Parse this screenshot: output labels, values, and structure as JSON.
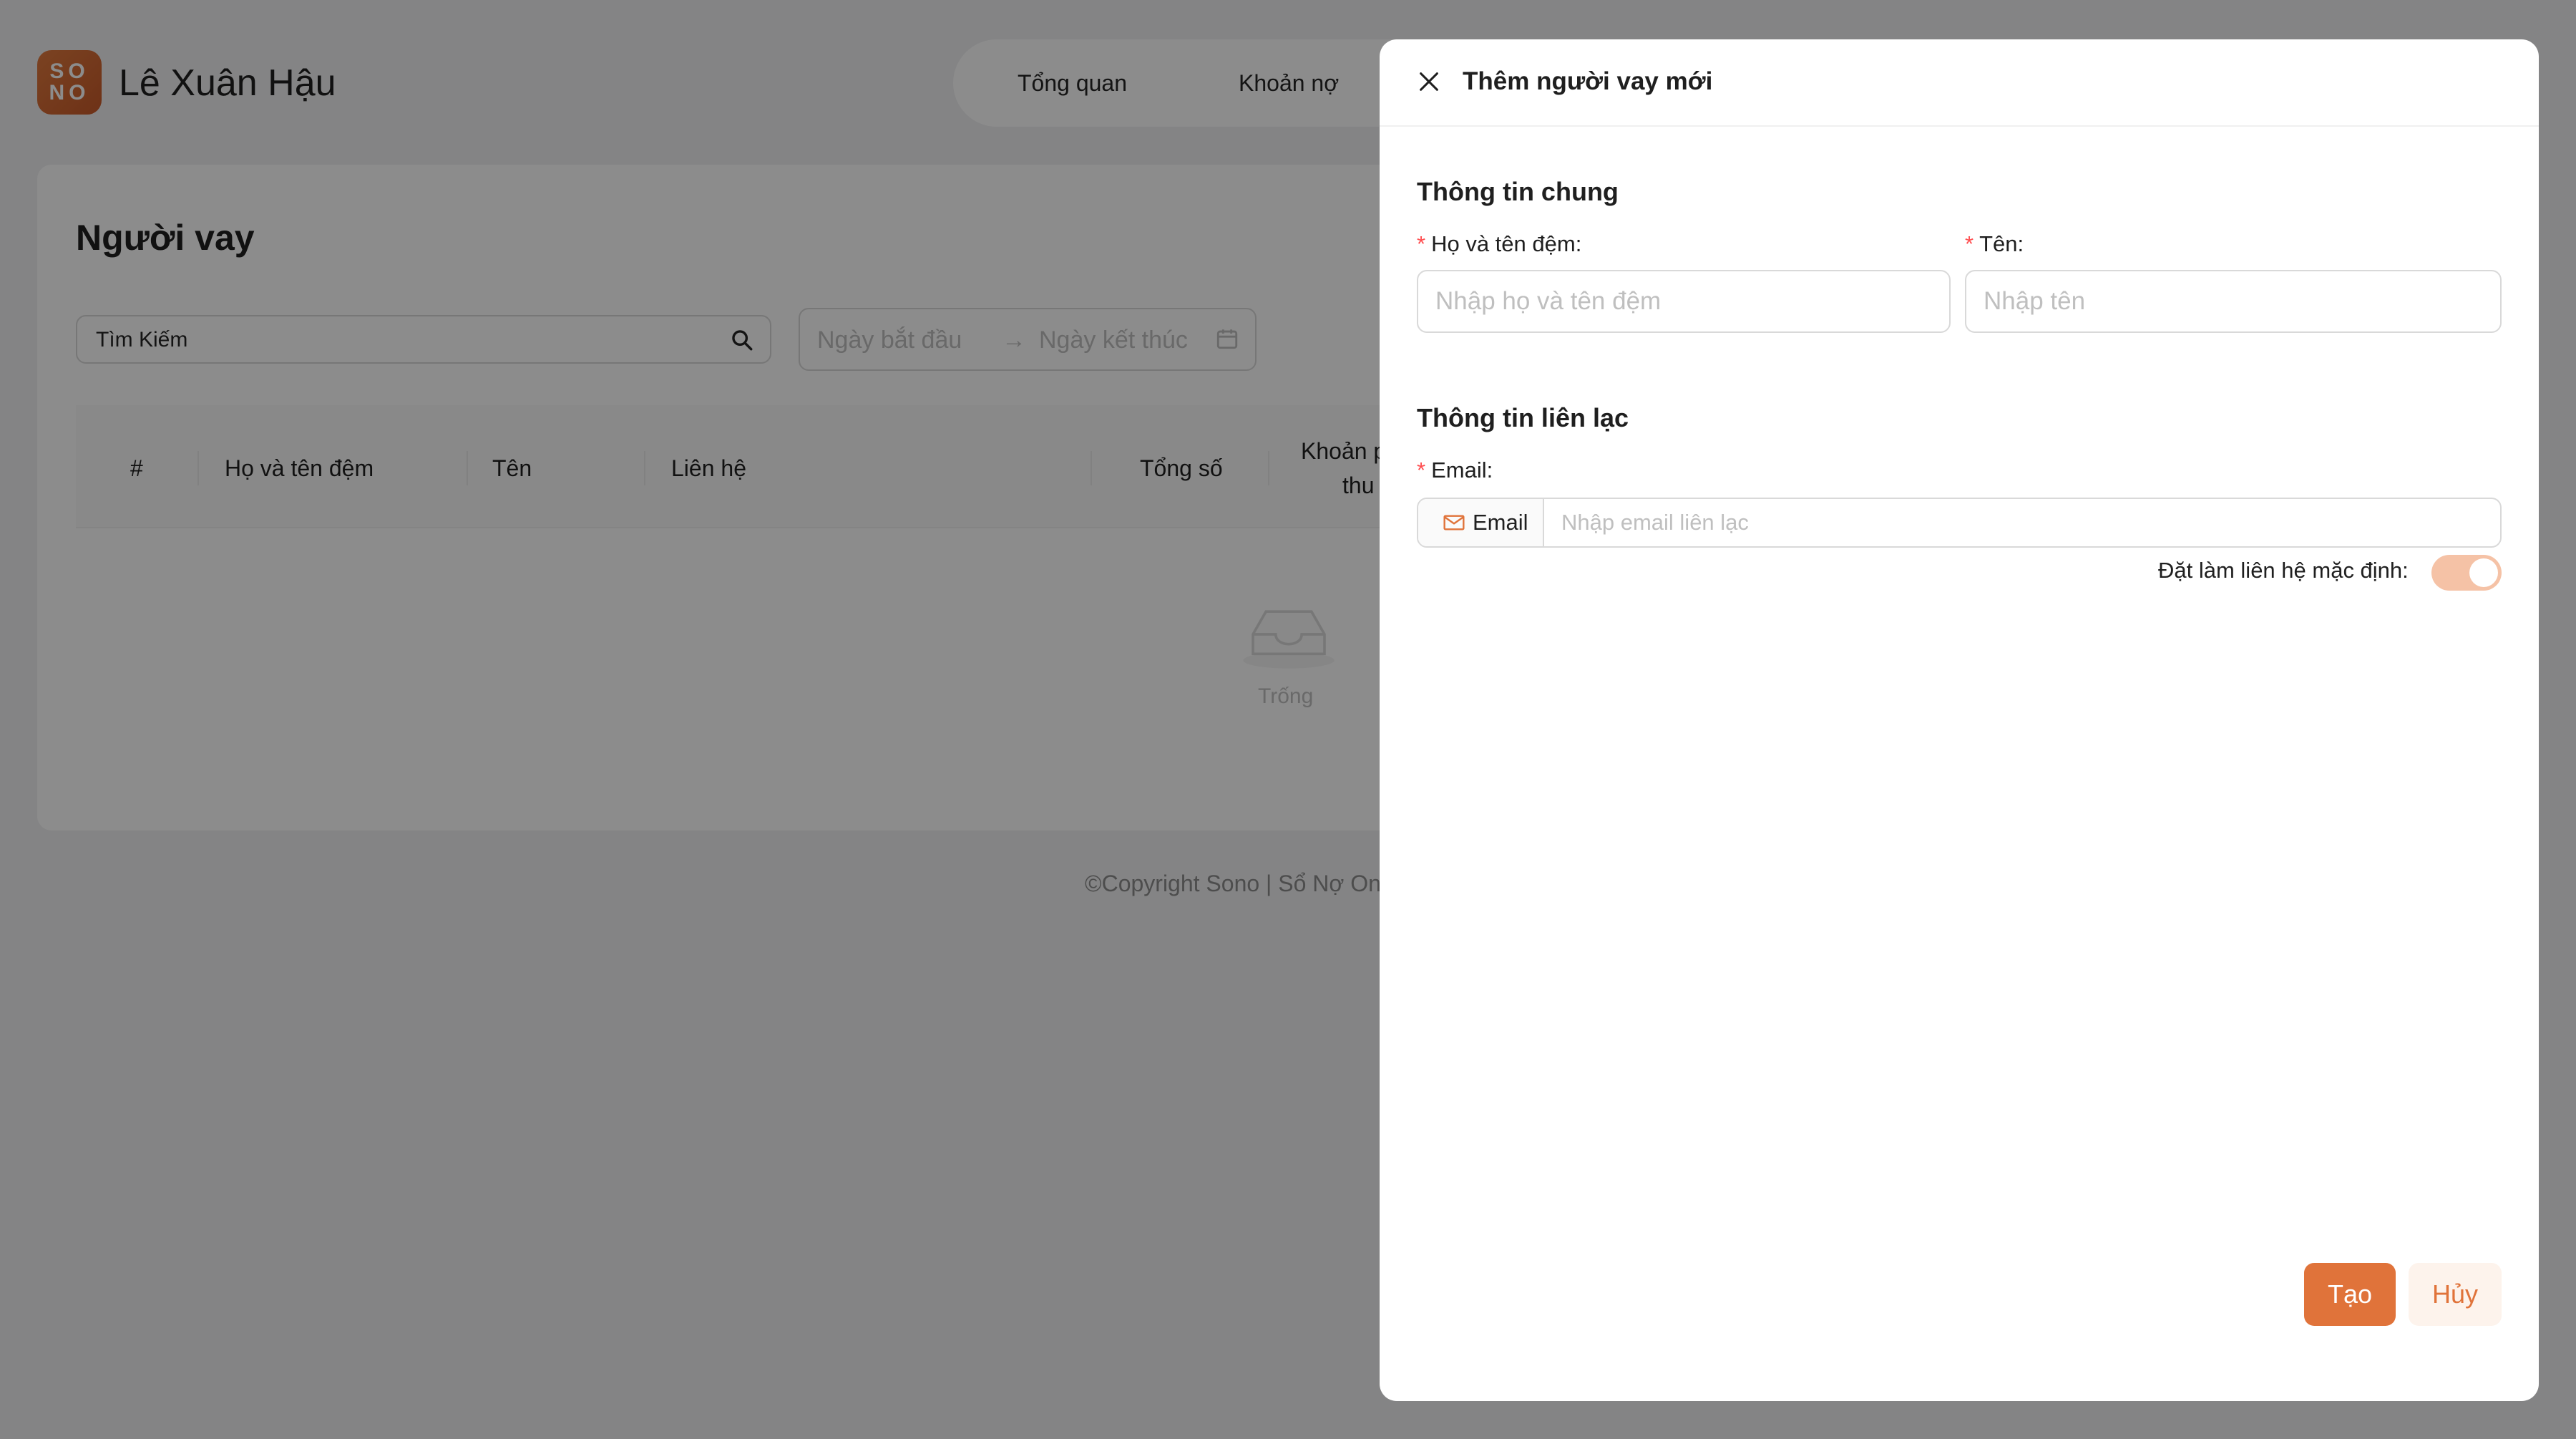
{
  "app": {
    "logo_text": "SONO",
    "user_name": "Lê Xuân Hậu"
  },
  "nav": {
    "items": [
      "Tổng quan",
      "Khoản nợ"
    ]
  },
  "page": {
    "title": "Người vay",
    "search": {
      "value": "Tìm Kiếm"
    },
    "date_range": {
      "start_placeholder": "Ngày bắt đầu",
      "arrow": "→",
      "end_placeholder": "Ngày kết thúc"
    },
    "table": {
      "columns": [
        "#",
        "Họ và tên đệm",
        "Tên",
        "Liên hệ",
        "Tổng số",
        "Khoản p",
        "thu"
      ]
    },
    "empty_text": "Trống",
    "copyright": "©Copyright Sono | Sổ Nợ On"
  },
  "drawer": {
    "title": "Thêm người vay mới",
    "general_section": "Thông tin chung",
    "fields": {
      "middle_name": {
        "label": "Họ và tên đệm",
        "placeholder": "Nhập họ và tên đệm",
        "required_mark": "*",
        "colon": ":"
      },
      "first_name": {
        "label": "Tên",
        "placeholder": "Nhập tên",
        "required_mark": "*",
        "colon": ":"
      }
    },
    "contact_section": "Thông tin liên lạc",
    "email": {
      "label": "Email",
      "required_mark": "*",
      "colon": ":",
      "addon_label": "Email",
      "placeholder": "Nhập email liên lạc"
    },
    "default_contact": {
      "label": "Đặt làm liên hệ mặc định",
      "colon": ":",
      "checked": true
    },
    "buttons": {
      "create": "Tạo",
      "cancel": "Hủy"
    }
  },
  "colors": {
    "accent": "#e0733a",
    "toggle_on": "#f5c2a6",
    "mask": "rgba(0,0,0,0.45)"
  }
}
